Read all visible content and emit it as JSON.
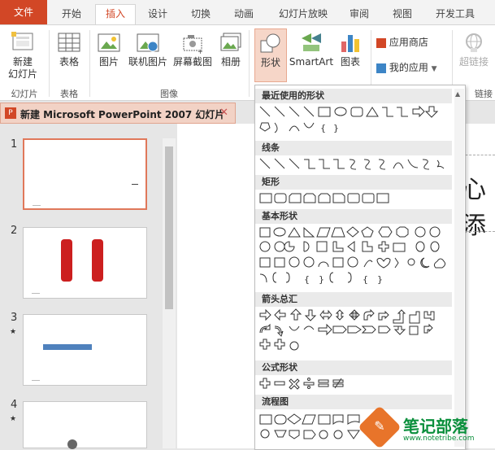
{
  "ribbon_tabs": [
    "文件",
    "开始",
    "插入",
    "设计",
    "切换",
    "动画",
    "幻灯片放映",
    "审阅",
    "视图",
    "开发工具"
  ],
  "ribbon_buttons": {
    "new_slide": "新建\n幻灯片",
    "table": "表格",
    "picture": "图片",
    "online_picture": "联机图片",
    "screenshot": "屏幕截图",
    "album": "相册",
    "shapes": "形状",
    "smartart": "SmartArt",
    "chart": "图表",
    "app_store": "应用商店",
    "my_apps": "我的应用",
    "hyperlink": "超链接"
  },
  "ribbon_groups": [
    "幻灯片",
    "表格",
    "图像",
    "链接"
  ],
  "document_tab": "新建 Microsoft PowerPoint 2007 幻灯片",
  "slides": [
    {
      "number": "1",
      "star": ""
    },
    {
      "number": "2",
      "star": ""
    },
    {
      "number": "3",
      "star": "★"
    },
    {
      "number": "4",
      "star": "★"
    }
  ],
  "slide_text_fragment": "心添",
  "shape_sections": [
    "最近使用的形状",
    "线条",
    "矩形",
    "基本形状",
    "箭头总汇",
    "公式形状",
    "流程图"
  ],
  "watermark": {
    "title": "笔记部落",
    "url": "www.notetribe.com"
  },
  "colors": {
    "accent": "#d24726",
    "selected_border": "#e0785a"
  }
}
